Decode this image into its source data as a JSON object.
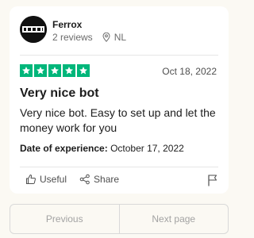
{
  "reviewer": {
    "name": "Ferrox",
    "reviews_count": "2 reviews",
    "country": "NL"
  },
  "review": {
    "rating": 5,
    "date": "Oct 18, 2022",
    "title": "Very nice bot",
    "body": "Very nice bot. Easy to set up and let the money work for you",
    "experience_label": "Date of experience:",
    "experience_date": "October 17, 2022"
  },
  "actions": {
    "useful_label": "Useful",
    "share_label": "Share"
  },
  "pagination": {
    "previous_label": "Previous",
    "next_label": "Next page"
  },
  "colors": {
    "star_green": "#00b67a",
    "background": "#fbf9f3",
    "card": "#ffffff"
  },
  "icons": [
    "avatar-logo",
    "location-pin-icon",
    "star-icon",
    "thumbs-up-icon",
    "share-icon",
    "flag-icon"
  ]
}
